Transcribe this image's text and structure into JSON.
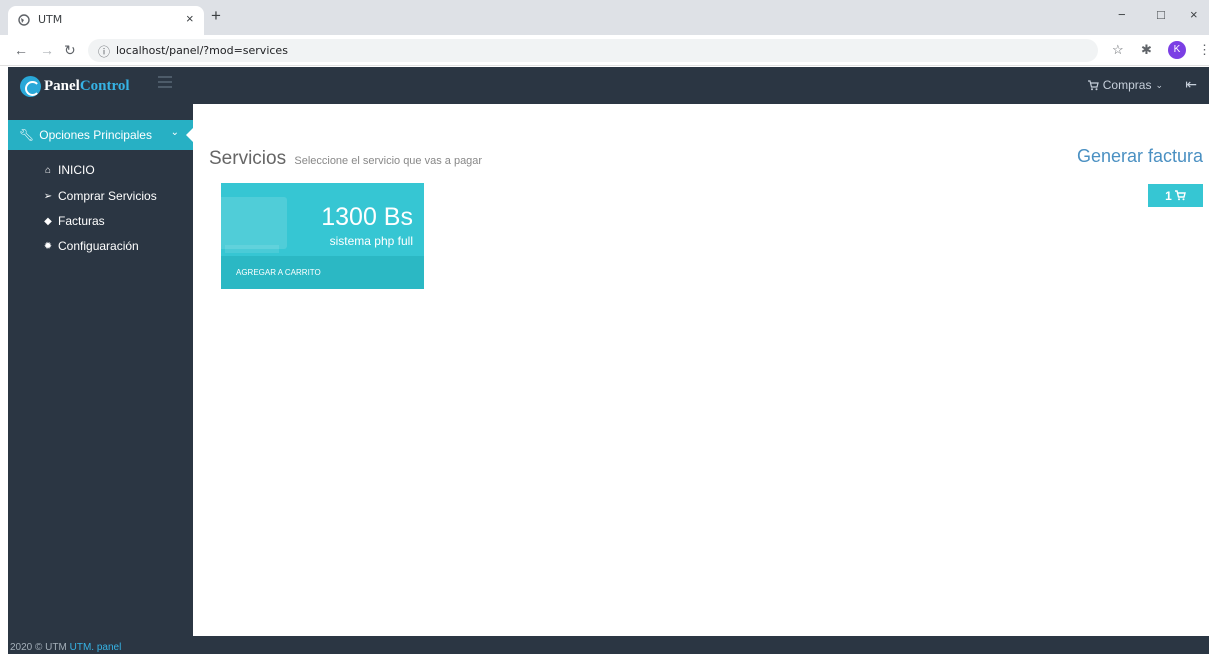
{
  "browser": {
    "tab_title": "UTM",
    "tab_close": "×",
    "new_tab": "+",
    "url": "localhost/panel/?mod=services",
    "avatar_letter": "K",
    "window_controls": {
      "minimize": "−",
      "maximize": "□",
      "close": "×"
    }
  },
  "header": {
    "logo_part1": "Panel",
    "logo_part2": "Control",
    "compras_label": "Compras"
  },
  "sidebar": {
    "main_label": "Opciones Principales",
    "items": [
      {
        "label": "INICIO",
        "icon": "home-icon"
      },
      {
        "label": "Comprar Servicios",
        "icon": "send-icon"
      },
      {
        "label": "Facturas",
        "icon": "tag-icon"
      },
      {
        "label": "Configuaración",
        "icon": "gear-icon"
      }
    ]
  },
  "main": {
    "title": "Servicios",
    "subtitle": "Seleccione el servicio que vas a pagar",
    "generate_label": "Generar factura",
    "cart_count": "1",
    "service": {
      "price": "1300 Bs",
      "description": "sistema php full",
      "action": "AGREGAR A CARRITO"
    }
  },
  "footer": {
    "text": "2020 © UTM",
    "link": "UTM. panel"
  },
  "colors": {
    "dark": "#2b3643",
    "accent": "#36c6d3",
    "link": "#4a90c2",
    "avatar": "#7b3fe4"
  }
}
